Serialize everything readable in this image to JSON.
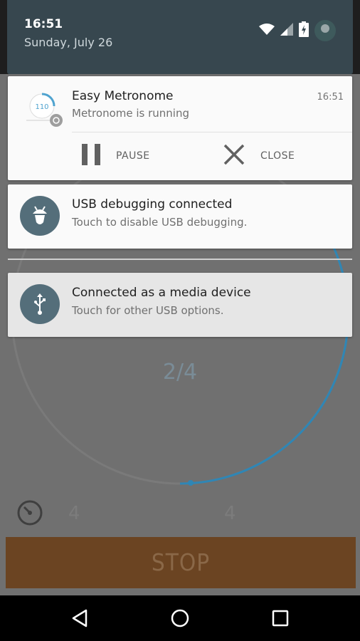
{
  "status_bar": {
    "time": "16:51",
    "date": "Sunday, July 26",
    "icons": [
      "wifi-icon",
      "signal-icon",
      "battery-charging-icon",
      "avatar"
    ]
  },
  "notifications": [
    {
      "app": "Easy Metronome",
      "text": "Metronome is running",
      "time": "16:51",
      "icon": "metronome-app-icon",
      "icon_text": "110",
      "actions": [
        {
          "label": "PAUSE",
          "icon": "pause-icon"
        },
        {
          "label": "CLOSE",
          "icon": "close-icon"
        }
      ]
    },
    {
      "app": "USB debugging connected",
      "text": "Touch to disable USB debugging.",
      "icon": "android-debug-icon"
    },
    {
      "app": "Connected as a media device",
      "text": "Touch for other USB options.",
      "icon": "usb-icon"
    }
  ],
  "background_app": {
    "beat": "2/4",
    "beats_left": "4",
    "beats_right": "4",
    "stop_label": "STOP",
    "accent_color": "#4fa3cf",
    "stop_color": "#e07b2a"
  },
  "nav_bar": {
    "buttons": [
      "back-icon",
      "home-icon",
      "recents-icon"
    ]
  }
}
